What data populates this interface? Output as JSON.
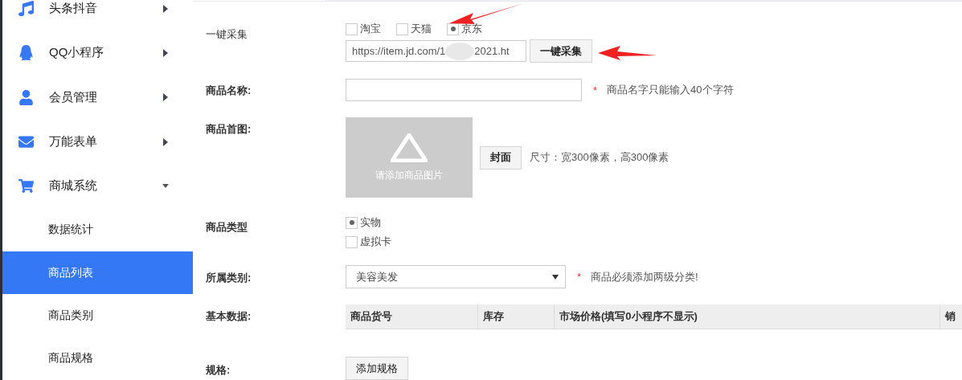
{
  "sidebar": {
    "items": [
      {
        "label": "头条抖音",
        "expanded": false
      },
      {
        "label": "QQ小程序",
        "expanded": false
      },
      {
        "label": "会员管理",
        "expanded": false
      },
      {
        "label": "万能表单",
        "expanded": false
      },
      {
        "label": "商城系统",
        "expanded": true,
        "children": [
          {
            "label": "数据统计",
            "selected": false
          },
          {
            "label": "商品列表",
            "selected": true
          },
          {
            "label": "商品类别",
            "selected": false
          },
          {
            "label": "商品规格",
            "selected": false
          }
        ]
      }
    ]
  },
  "form": {
    "collect": {
      "label": "一键采集",
      "sources": [
        {
          "label": "淘宝",
          "selected": false
        },
        {
          "label": "天猫",
          "selected": false
        },
        {
          "label": "京东",
          "selected": true
        }
      ],
      "url_start": "https://item.jd.com/1",
      "url_end": "2021.ht",
      "button": "一键采集"
    },
    "name": {
      "label": "商品名称:",
      "required_mark": "*",
      "hint": "商品名字只能输入40个字符"
    },
    "image": {
      "label": "商品首图:",
      "placeholder": "请添加商品图片",
      "button": "封面",
      "note": "尺寸：宽300像素，高300像素"
    },
    "type": {
      "label": "商品类型",
      "options": [
        {
          "label": "实物",
          "selected": true
        },
        {
          "label": "虚拟卡",
          "selected": false
        }
      ]
    },
    "category": {
      "label": "所属类别:",
      "value": "美容美发",
      "required_mark": "*",
      "hint": "商品必须添加两级分类!"
    },
    "basic": {
      "label": "基本数据:",
      "columns": [
        "商品货号",
        "库存",
        "市场价格(填写0小程序不显示)",
        "销"
      ]
    },
    "spec": {
      "label": "规格:",
      "button": "添加规格"
    }
  }
}
